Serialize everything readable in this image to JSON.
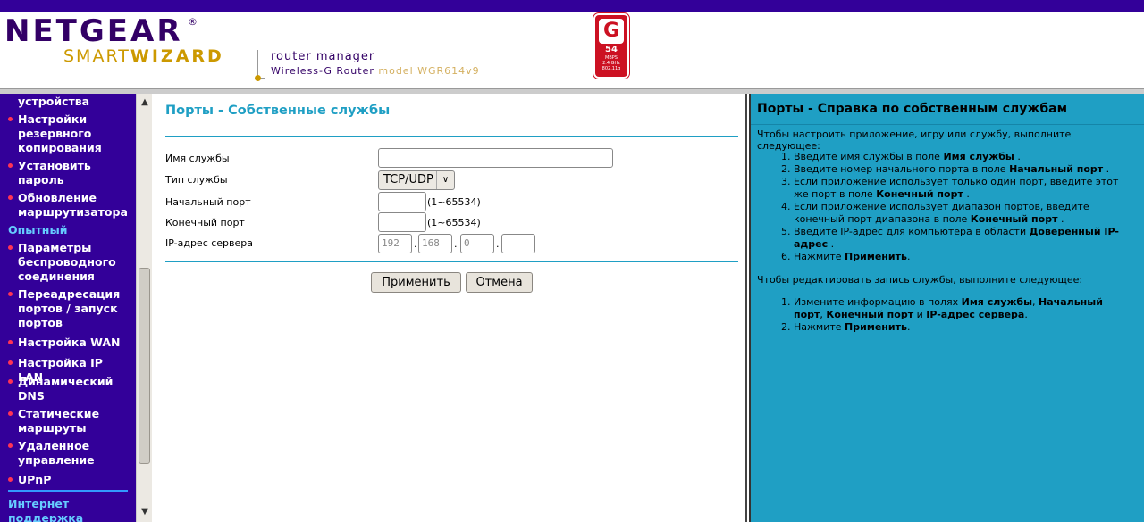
{
  "header": {
    "brand": "NETGEAR",
    "registered": "®",
    "smart": "SMART",
    "wizard": "WIZARD",
    "subtitle": "router manager",
    "product": "Wireless-G Router",
    "model": "model WGR614v9",
    "badge": {
      "letter": "G",
      "speed": "54",
      "unit": "MBPS",
      "band": "2.4 GHz",
      "std": "802.11g"
    }
  },
  "sidebar": {
    "items": [
      {
        "label": "устройства",
        "bullet": false
      },
      {
        "label": "Настройки резервного копирования",
        "bullet": true
      },
      {
        "label": "Установить пароль",
        "bullet": true
      },
      {
        "label": "Обновление маршрутизатора",
        "bullet": true
      }
    ],
    "section_advanced": "Опытный",
    "advanced_items": [
      {
        "label": "Параметры беспроводного соединения"
      },
      {
        "label": "Переадресация портов / запуск портов"
      },
      {
        "label": "Настройка WAN"
      },
      {
        "label": "Настройка IP LAN"
      },
      {
        "label": "Динамический DNS"
      },
      {
        "label": "Статические маршруты"
      },
      {
        "label": "Удаленное управление"
      },
      {
        "label": "UPnP"
      }
    ],
    "section_support": "Интернет поддержка"
  },
  "main": {
    "title": "Порты - Собственные службы",
    "fields": {
      "service_name_label": "Имя службы",
      "service_name_value": "",
      "service_type_label": "Тип службы",
      "service_type_value": "TCP/UDP",
      "start_port_label": "Начальный порт",
      "start_port_value": "",
      "start_port_range": "(1~65534)",
      "end_port_label": "Конечный порт",
      "end_port_value": "",
      "end_port_range": "(1~65534)",
      "ip_label": "IP-адрес сервера",
      "ip": [
        "192",
        "168",
        "0",
        ""
      ]
    },
    "apply_label": "Применить",
    "cancel_label": "Отмена"
  },
  "help": {
    "title": "Порты - Справка по собственным службам",
    "intro1": "Чтобы настроить приложение, игру или службу, выполните следующее:",
    "steps1": [
      [
        "Введите имя службы в поле ",
        "Имя службы",
        " ."
      ],
      [
        "Введите номер начального порта в поле ",
        "Начальный порт",
        " ."
      ],
      [
        "Если приложение использует только один порт, введите этот же порт в поле ",
        "Конечный порт",
        " ."
      ],
      [
        "Если приложение использует диапазон портов, введите конечный порт диапазона в поле ",
        "Конечный порт",
        " ."
      ],
      [
        "Введите IP-адрес для компьютера в области ",
        "Доверенный IP-адрес",
        " ."
      ],
      [
        "Нажмите ",
        "Применить",
        "."
      ]
    ],
    "intro2": "Чтобы редактировать запись службы, выполните следующее:",
    "steps2": [
      {
        "pre": "Измените информацию в полях ",
        "b1": "Имя службы",
        "sep1": ", ",
        "b2": "Начальный порт",
        "sep2": ", ",
        "b3": "Конечный порт",
        "sep3": " и ",
        "b4": "IP-адрес сервера",
        "end": "."
      },
      {
        "pre": "Нажмите ",
        "b1": "Применить",
        "end": "."
      }
    ]
  },
  "colors": {
    "top_bar": "#330099",
    "sidebar_bg": "#330099",
    "accent": "#1f9fc4",
    "bullet": "#ff3355",
    "section": "#66ccff"
  }
}
